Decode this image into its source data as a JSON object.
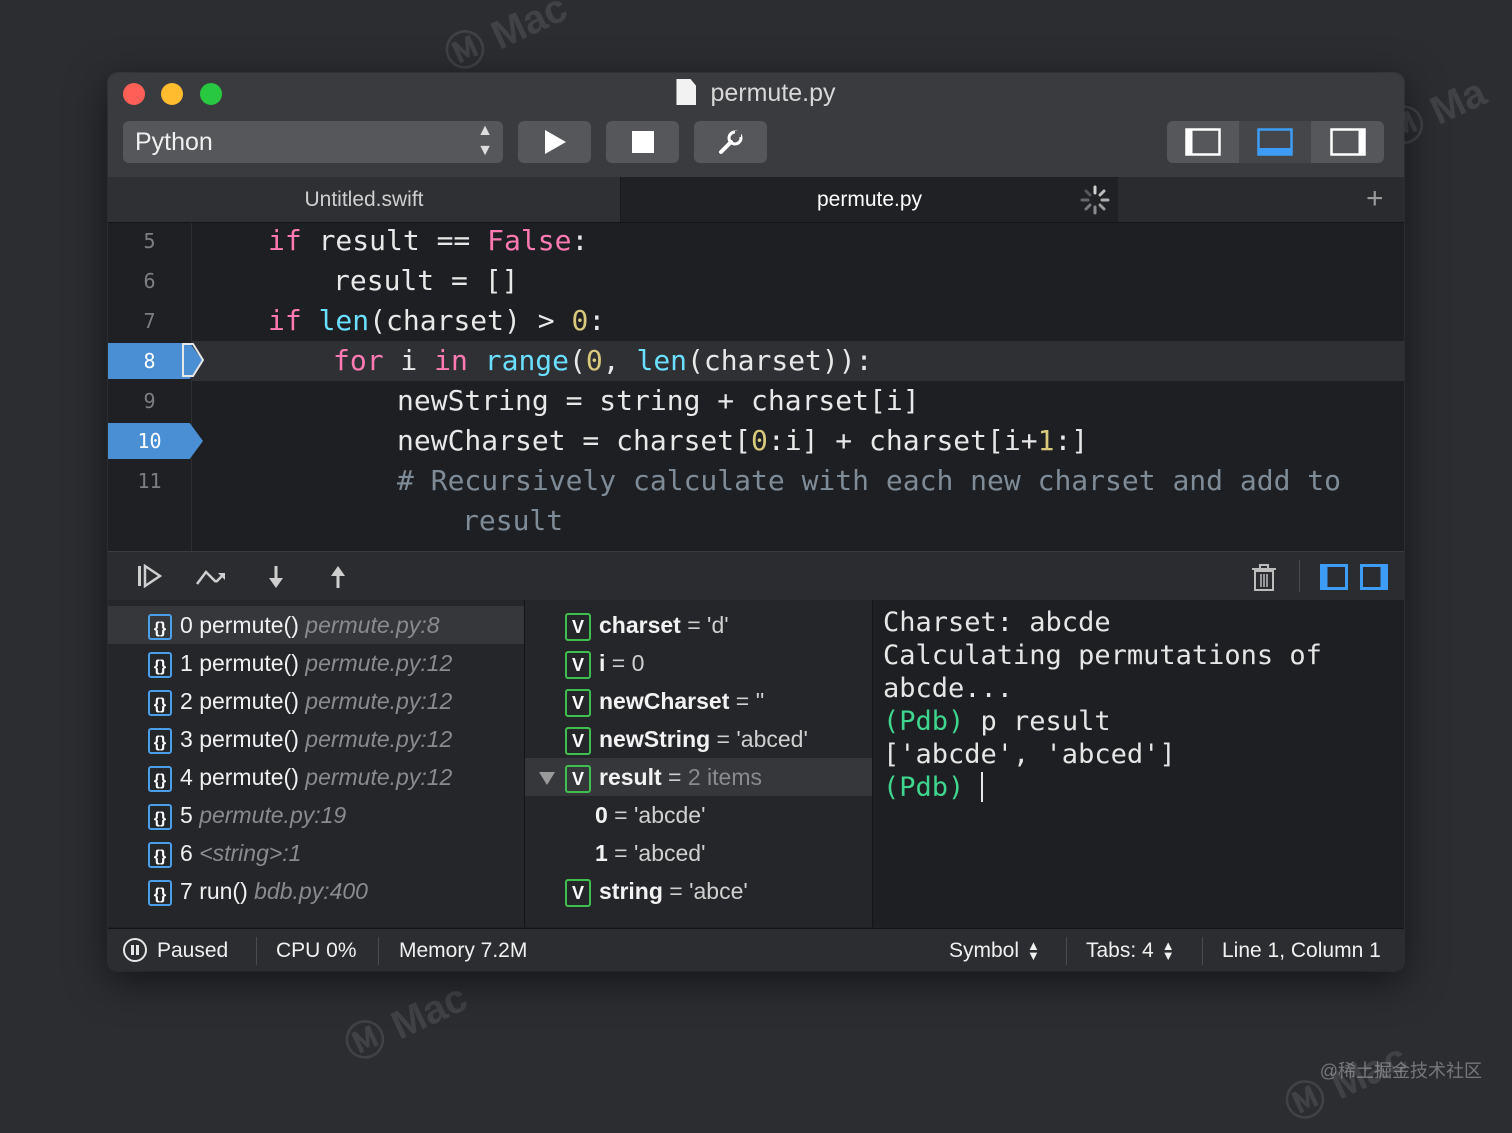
{
  "window": {
    "file_title": "permute.py",
    "language": "Python",
    "colors": {
      "breakpoint": "#4a8fd4",
      "keyword": "#ff7ab2",
      "function": "#6bdfff",
      "number": "#d9c97c",
      "comment": "#7f8c98",
      "pdb_prompt": "#3fd68f"
    }
  },
  "tabs": [
    {
      "label": "Untitled.swift"
    },
    {
      "label": "permute.py"
    }
  ],
  "editor": {
    "lines": [
      {
        "n": "5"
      },
      {
        "n": "6"
      },
      {
        "n": "7"
      },
      {
        "n": "8"
      },
      {
        "n": "9"
      },
      {
        "n": "10"
      },
      {
        "n": "11"
      }
    ],
    "code": {
      "l5_a": "if",
      "l5_b": " result == ",
      "l5_c": "False",
      "l5_d": ":",
      "l6": "result = []",
      "l7_a": "if",
      "l7_b": "len",
      "l7_c": "(charset) > ",
      "l7_d": "0",
      "l7_e": ":",
      "l8_a": "for",
      "l8_b": " i ",
      "l8_c": "in",
      "l8_d": "range",
      "l8_e": "(",
      "l8_f": "0",
      "l8_g": ", ",
      "l8_h": "len",
      "l8_i": "(charset)):",
      "l9": "newString = string + charset[i]",
      "l10_a": "newCharset = charset[",
      "l10_b": "0",
      "l10_c": ":i] + charset[i+",
      "l10_d": "1",
      "l10_e": ":]",
      "l11": "# Recursively calculate with each new charset and add to",
      "l11_wrap": "result"
    }
  },
  "frames": [
    {
      "idx": "0",
      "name": "permute()",
      "loc": "permute.py:8"
    },
    {
      "idx": "1",
      "name": "permute()",
      "loc": "permute.py:12"
    },
    {
      "idx": "2",
      "name": "permute()",
      "loc": "permute.py:12"
    },
    {
      "idx": "3",
      "name": "permute()",
      "loc": "permute.py:12"
    },
    {
      "idx": "4",
      "name": "permute()",
      "loc": "permute.py:12"
    },
    {
      "idx": "5",
      "name": "",
      "loc": "permute.py:19"
    },
    {
      "idx": "6",
      "name": "",
      "loc": "<string>:1"
    },
    {
      "idx": "7",
      "name": "run()",
      "loc": "bdb.py:400"
    }
  ],
  "variables": [
    {
      "badge": "V",
      "name": "charset",
      "eq": " = ",
      "value": "'d'"
    },
    {
      "badge": "V",
      "name": "i",
      "eq": " = ",
      "value": "0"
    },
    {
      "badge": "V",
      "name": "newCharset",
      "eq": " = ",
      "value": "''"
    },
    {
      "badge": "V",
      "name": "newString",
      "eq": " = ",
      "value": "'abced'"
    },
    {
      "badge": "V",
      "name": "result",
      "eq": " = ",
      "value": "2 items"
    },
    {
      "name": "0",
      "eq": " = ",
      "value": "'abcde'"
    },
    {
      "name": "1",
      "eq": " = ",
      "value": "'abced'"
    },
    {
      "badge": "V",
      "name": "string",
      "eq": " = ",
      "value": "'abce'"
    }
  ],
  "console": {
    "l1": "Charset: abcde",
    "l2": "Calculating permutations of",
    "l3": "abcde...",
    "l4_prompt": "(Pdb)",
    "l4_cmd": " p result",
    "l5": "['abcde', 'abced']",
    "l6_prompt": "(Pdb)"
  },
  "status": {
    "state": "Paused",
    "cpu": "CPU 0%",
    "memory": "Memory 7.2M",
    "symbol": "Symbol",
    "tabs": "Tabs: 4",
    "position": "Line 1, Column 1"
  },
  "footer_watermark": "@稀土掘金技术社区"
}
